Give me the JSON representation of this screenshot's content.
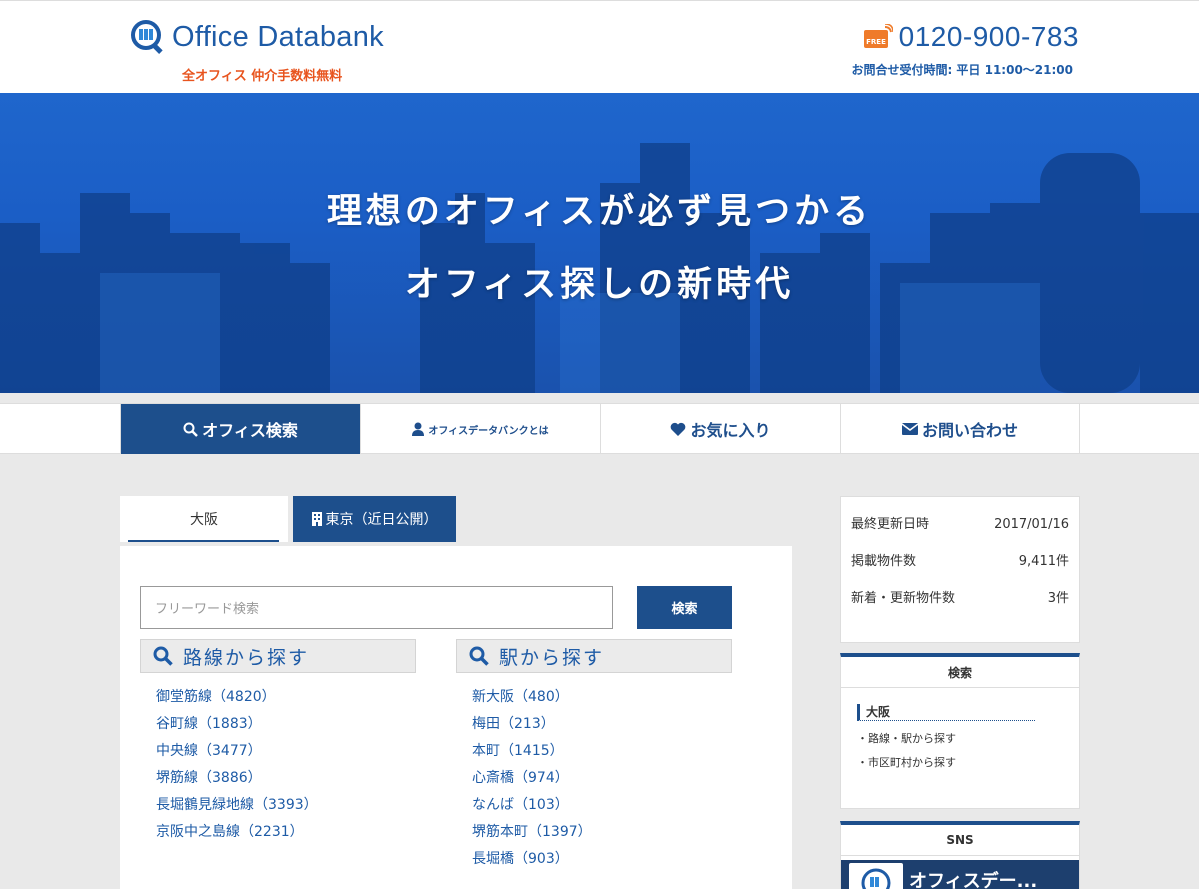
{
  "header": {
    "logo_text": "Office Databank",
    "tagline": "全オフィス 仲介手数料無料",
    "phone": "0120-900-783",
    "free_icon_label": "FREE",
    "hours": "お問合せ受付時間: 平日 11:00〜21:00",
    "colors": {
      "brand": "#1e5ba6",
      "tagline": "#e8541e"
    }
  },
  "hero": {
    "line1": "理想のオフィスが必ず見つかる",
    "line2": "オフィス探しの新時代"
  },
  "nav": {
    "items": [
      {
        "label": "オフィス検索",
        "icon": "search-icon",
        "active": true
      },
      {
        "label": "オフィスデータバンクとは",
        "icon": "user-icon",
        "active": false
      },
      {
        "label": "お気に入り",
        "icon": "heart-icon",
        "active": false
      },
      {
        "label": "お問い合わせ",
        "icon": "mail-icon",
        "active": false
      }
    ]
  },
  "tabs": {
    "osaka": "大阪",
    "tokyo": "東京（近日公開）"
  },
  "search": {
    "placeholder": "フリーワード検索",
    "button": "検索"
  },
  "lines": {
    "heading": "路線から探す",
    "items": [
      "御堂筋線（4820）",
      "谷町線（1883）",
      "中央線（3477）",
      "堺筋線（3886）",
      "長堀鶴見緑地線（3393）",
      "京阪中之島線（2231）"
    ]
  },
  "stations": {
    "heading": "駅から探す",
    "items": [
      "新大阪（480）",
      "梅田（213）",
      "本町（1415）",
      "心斎橋（974）",
      "なんば（103）",
      "堺筋本町（1397）",
      "長堀橋（903）"
    ]
  },
  "stats": [
    {
      "label": "最終更新日時",
      "value": "2017/01/16"
    },
    {
      "label": "掲載物件数",
      "value": "9,411件"
    },
    {
      "label": "新着・更新物件数",
      "value": "3件"
    }
  ],
  "sidebar_search": {
    "title": "検索",
    "region": "大阪",
    "links": [
      "・路線・駅から探す",
      "・市区町村から探す"
    ]
  },
  "sns": {
    "title": "SNS",
    "banner_text": "オフィスデー..."
  }
}
